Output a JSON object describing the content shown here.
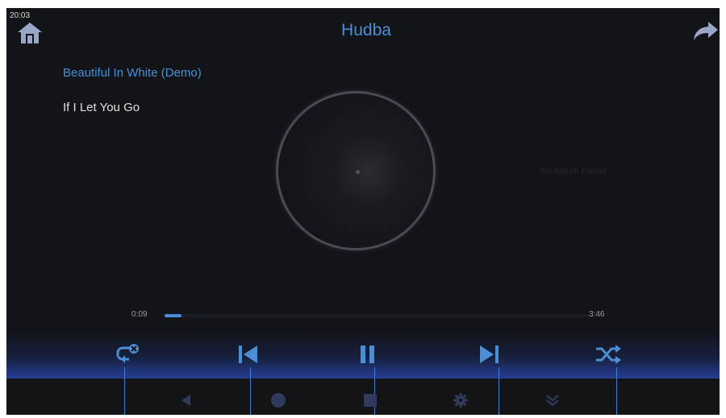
{
  "status_bar": {
    "time": "20:03"
  },
  "header": {
    "title": "Hudba",
    "home_icon": "home-icon",
    "share_icon": "share-icon"
  },
  "playlist": {
    "items": [
      {
        "title": "Beautiful In White (Demo)",
        "active": true
      },
      {
        "title": "If I Let You Go",
        "active": false
      }
    ]
  },
  "album_art": {
    "placeholder": "No Album Found"
  },
  "progress": {
    "elapsed": "0:09",
    "duration": "3:46",
    "fraction": 0.04
  },
  "controls": [
    {
      "name": "repeat-off-icon"
    },
    {
      "name": "previous-track-icon"
    },
    {
      "name": "pause-icon"
    },
    {
      "name": "next-track-icon"
    },
    {
      "name": "shuffle-icon"
    }
  ],
  "navbar": {
    "icons": [
      "back-icon",
      "home-circle-icon",
      "recents-icon",
      "settings-icon",
      "collapse-icon"
    ]
  },
  "colors": {
    "accent": "#4a8fd6",
    "background": "#131418"
  }
}
